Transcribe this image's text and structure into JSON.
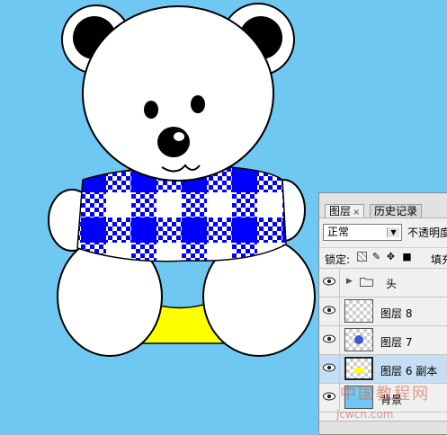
{
  "colors": {
    "background": "#6ec8f2",
    "shirt_blue": "#0000ff",
    "shorts_yellow": "#ffff00",
    "ear_inner": "#000000",
    "fur": "#ffffff"
  },
  "panel": {
    "tabs": [
      {
        "label": "图层",
        "close": "×",
        "active": true
      },
      {
        "label": "历史记录",
        "active": false
      }
    ],
    "blend_mode": "正常",
    "opacity_label": "不透明度",
    "lock_label": "锁定:",
    "fill_label": "填充",
    "lock_icons": [
      "lock-transparency-icon",
      "lock-image-icon",
      "lock-position-icon",
      "lock-all-icon"
    ],
    "layers": [
      {
        "name": "头",
        "type": "group",
        "visible": true
      },
      {
        "name": "图层 8",
        "type": "layer",
        "visible": true
      },
      {
        "name": "图层 7",
        "type": "layer",
        "visible": true
      },
      {
        "name": "图层 6 副本",
        "type": "layer",
        "visible": true,
        "selected": true
      },
      {
        "name": "背景",
        "type": "background",
        "visible": true
      }
    ]
  },
  "watermark": {
    "line1": "中国教程网",
    "line2": "jcwcn.com"
  }
}
